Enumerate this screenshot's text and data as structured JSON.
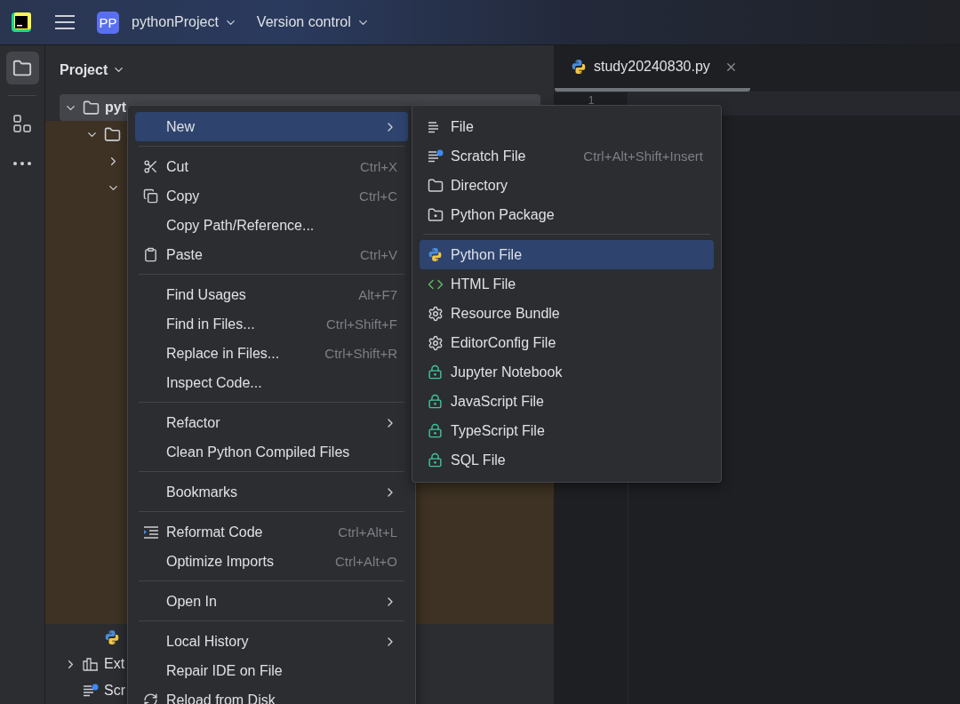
{
  "top_bar": {
    "project_badge": "PP",
    "project_name": "pythonProject",
    "version_control": "Version control"
  },
  "left_toolbar": [
    {
      "kind": "project",
      "selected": true
    },
    {
      "kind": "structure",
      "selected": false
    },
    {
      "kind": "more",
      "selected": false
    }
  ],
  "project_panel": {
    "title": "Project",
    "items": [
      {
        "kind": "folder",
        "label": "pyt",
        "expanded": true,
        "selected": true,
        "children": [
          {
            "kind": "folder",
            "expanded": true,
            "highlighted": true,
            "children": [
              {
                "expanded": false
              },
              {
                "expanded": true
              }
            ]
          },
          {
            "kind": "python-file"
          }
        ]
      },
      {
        "kind": "libraries",
        "label": "Ext",
        "expanded": false
      },
      {
        "kind": "scratches",
        "label": "Scr"
      }
    ]
  },
  "editor": {
    "tabs": [
      {
        "label": "study20240830.py",
        "selected": true
      }
    ],
    "line_numbers": [
      "1"
    ]
  },
  "context_menu": {
    "groups": [
      [
        {
          "label": "New",
          "kind": "plain",
          "submenu": true,
          "selected": true
        }
      ],
      [
        {
          "label": "Cut",
          "shortcut": "Ctrl+X",
          "kind": "cut",
          "submenu": false,
          "selected": false
        },
        {
          "label": "Copy",
          "shortcut": "Ctrl+C",
          "kind": "copy",
          "submenu": false,
          "selected": false
        },
        {
          "label": "Copy Path/Reference...",
          "kind": "plain",
          "submenu": false,
          "selected": false
        },
        {
          "label": "Paste",
          "shortcut": "Ctrl+V",
          "kind": "paste",
          "submenu": false,
          "selected": false
        }
      ],
      [
        {
          "label": "Find Usages",
          "shortcut": "Alt+F7",
          "kind": "plain",
          "submenu": false,
          "selected": false
        },
        {
          "label": "Find in Files...",
          "shortcut": "Ctrl+Shift+F",
          "kind": "plain",
          "submenu": false,
          "selected": false
        },
        {
          "label": "Replace in Files...",
          "shortcut": "Ctrl+Shift+R",
          "kind": "plain",
          "submenu": false,
          "selected": false
        },
        {
          "label": "Inspect Code...",
          "kind": "plain",
          "submenu": false,
          "selected": false
        }
      ],
      [
        {
          "label": "Refactor",
          "kind": "plain",
          "submenu": true,
          "selected": false
        },
        {
          "label": "Clean Python Compiled Files",
          "kind": "plain",
          "submenu": false,
          "selected": false
        }
      ],
      [
        {
          "label": "Bookmarks",
          "kind": "plain",
          "submenu": true,
          "selected": false
        }
      ],
      [
        {
          "label": "Reformat Code",
          "shortcut": "Ctrl+Alt+L",
          "kind": "reformat",
          "submenu": false,
          "selected": false
        },
        {
          "label": "Optimize Imports",
          "shortcut": "Ctrl+Alt+O",
          "kind": "plain",
          "submenu": false,
          "selected": false
        }
      ],
      [
        {
          "label": "Open In",
          "kind": "plain",
          "submenu": true,
          "selected": false
        }
      ],
      [
        {
          "label": "Local History",
          "kind": "plain",
          "submenu": true,
          "selected": false
        },
        {
          "label": "Repair IDE on File",
          "kind": "plain",
          "submenu": false,
          "selected": false
        },
        {
          "label": "Reload from Disk",
          "kind": "reload",
          "submenu": false,
          "selected": false
        }
      ]
    ]
  },
  "new_submenu": {
    "groups": [
      [
        {
          "label": "File",
          "kind": "file",
          "selected": false
        },
        {
          "label": "Scratch File",
          "shortcut": "Ctrl+Alt+Shift+Insert",
          "kind": "scratch",
          "selected": false
        },
        {
          "label": "Directory",
          "kind": "folder",
          "selected": false
        },
        {
          "label": "Python Package",
          "kind": "package",
          "selected": false
        }
      ],
      [
        {
          "label": "Python File",
          "kind": "python",
          "selected": true
        },
        {
          "label": "HTML File",
          "kind": "html",
          "selected": false
        },
        {
          "label": "Resource Bundle",
          "kind": "gear",
          "selected": false
        },
        {
          "label": "EditorConfig File",
          "kind": "gear",
          "selected": false
        },
        {
          "label": "Jupyter Notebook",
          "kind": "lock",
          "selected": false
        },
        {
          "label": "JavaScript File",
          "kind": "lock",
          "selected": false
        },
        {
          "label": "TypeScript File",
          "kind": "lock",
          "selected": false
        },
        {
          "label": "SQL File",
          "kind": "lock",
          "selected": false
        }
      ]
    ]
  }
}
